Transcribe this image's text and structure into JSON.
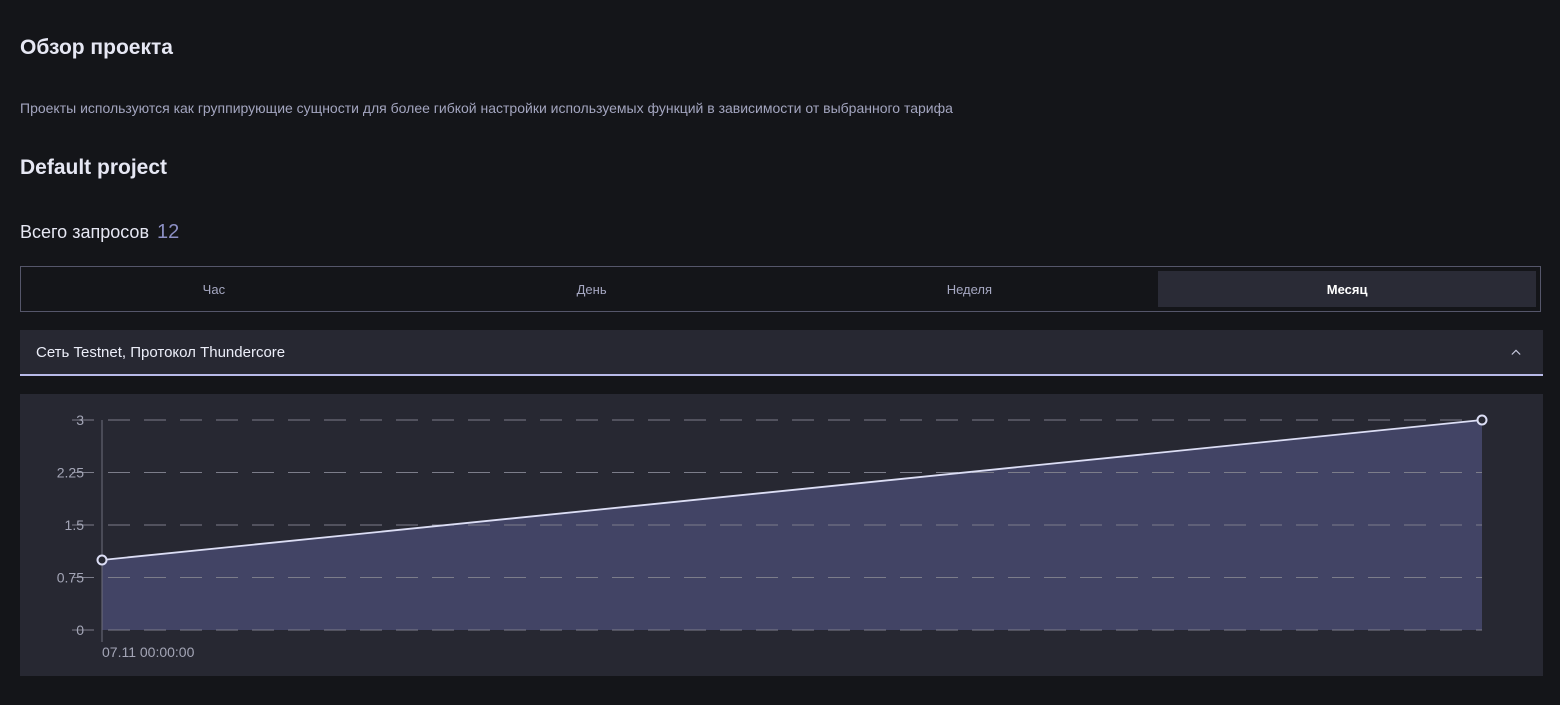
{
  "page": {
    "title": "Обзор проекта",
    "description": "Проекты используются как группирующие сущности для более гибкой настройки используемых функций в зависимости от выбранного тарифа"
  },
  "project": {
    "name": "Default project",
    "total_label": "Всего запросов",
    "total_value": "12"
  },
  "period_tabs": [
    {
      "label": "Час",
      "active": false
    },
    {
      "label": "День",
      "active": false
    },
    {
      "label": "Неделя",
      "active": false
    },
    {
      "label": "Месяц",
      "active": true
    }
  ],
  "network_section": {
    "title": "Сеть Testnet, Протокол Thundercore",
    "expanded": true
  },
  "colors": {
    "accent_line": "#dcdef5",
    "area_fill": "#424465",
    "grid": "#7c7d8a",
    "tick_text": "#a3a5b6"
  },
  "chart_data": {
    "type": "area",
    "x": [
      "07.11 00:00:00",
      ""
    ],
    "x_tick_labels": [
      "07.11 00:00:00"
    ],
    "series": [
      {
        "values": [
          1,
          3
        ]
      }
    ],
    "y_ticks": [
      0,
      0.75,
      1.5,
      2.25,
      3
    ],
    "y_tick_labels": [
      "0",
      "0.75",
      "1.5",
      "2.25",
      "3"
    ],
    "ylim": [
      0,
      3
    ],
    "grid": true
  }
}
